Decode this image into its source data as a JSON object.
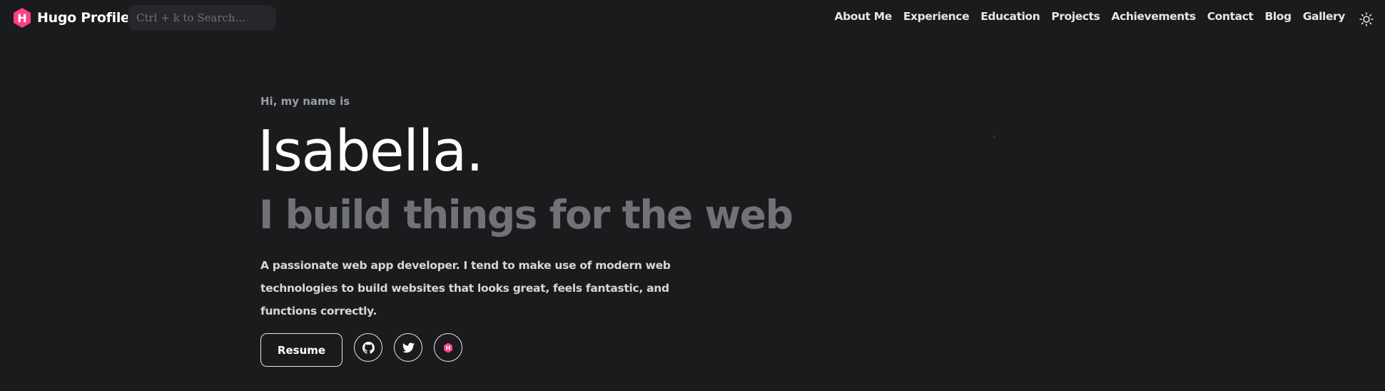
{
  "navbar": {
    "brand": "Hugo Profile",
    "search_placeholder": "Ctrl + k to Search...",
    "links": [
      "About Me",
      "Experience",
      "Education",
      "Projects",
      "Achievements",
      "Contact",
      "Blog",
      "Gallery"
    ],
    "theme_icon": "sun-icon"
  },
  "hero": {
    "greeting": "Hi, my name is",
    "name": "Isabella.",
    "tagline": "I build things for the web",
    "description": "A passionate web app developer. I tend to make use of modern web technologies to build websites that looks great, feels fantastic, and functions correctly.",
    "resume_label": "Resume",
    "socials": [
      "github-icon",
      "twitter-icon",
      "hugo-icon"
    ]
  },
  "colors": {
    "background": "#1a1b1d",
    "brand_accent": "#ff4088",
    "muted": "#707276"
  }
}
